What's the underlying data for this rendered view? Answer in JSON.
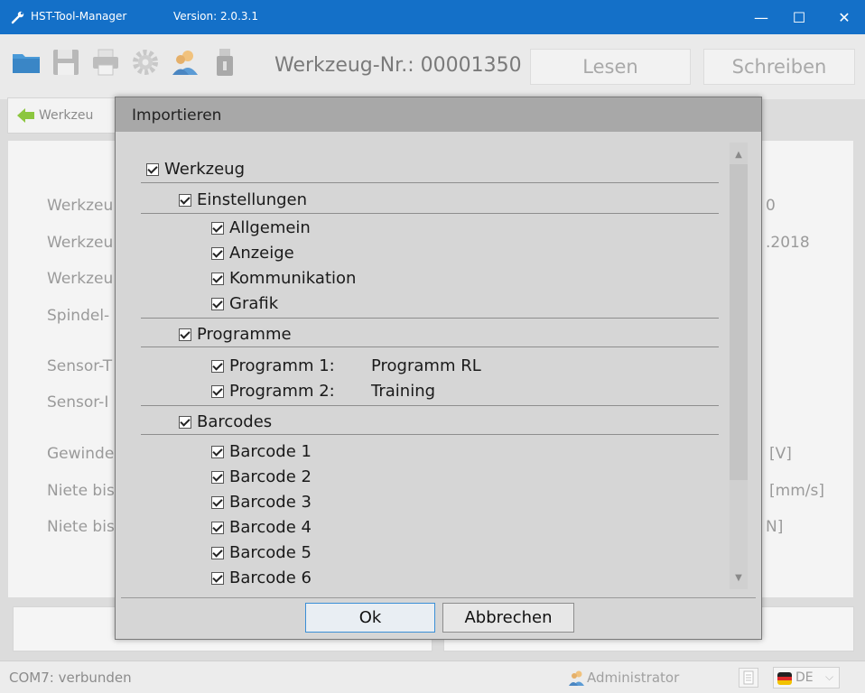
{
  "window": {
    "title": "HST-Tool-Manager",
    "version": "Version: 2.0.3.1",
    "controls": [
      "—",
      "☐",
      "✕"
    ]
  },
  "toolbar": {
    "tool_number": "Werkzeug-Nr.: 00001350",
    "read_label": "Lesen",
    "write_label": "Schreiben",
    "icons": [
      "folder-icon",
      "save-icon",
      "print-icon",
      "settings-icon",
      "users-icon",
      "usb-icon"
    ]
  },
  "breadcrumb": {
    "label": "Werkzeu"
  },
  "background_labels": {
    "left": [
      "Werkzeu",
      "Werkzeu",
      "Werkzeu",
      "Spindel-",
      "Sensor-T",
      "Sensor-I",
      "Gewinde",
      "Niete bis",
      "Niete bis"
    ],
    "right": [
      "0",
      ".2018",
      "[V]",
      "[mm/s]",
      "N]"
    ]
  },
  "dialog": {
    "title": "Importieren",
    "ok_label": "Ok",
    "cancel_label": "Abbrechen",
    "tree": {
      "root": "Werkzeug",
      "settings": {
        "label": "Einstellungen",
        "items": [
          "Allgemein",
          "Anzeige",
          "Kommunikation",
          "Grafik"
        ]
      },
      "programs": {
        "label": "Programme",
        "items": [
          {
            "label": "Programm 1:",
            "value": "Programm RL"
          },
          {
            "label": "Programm 2:",
            "value": "Training"
          }
        ]
      },
      "barcodes": {
        "label": "Barcodes",
        "items": [
          "Barcode 1",
          "Barcode 2",
          "Barcode 3",
          "Barcode 4",
          "Barcode 5",
          "Barcode 6"
        ]
      }
    }
  },
  "statusbar": {
    "connection": "COM7: verbunden",
    "user": "Administrator",
    "language": "DE"
  },
  "colors": {
    "titlebar": "#1470c8",
    "dialog_bg": "#d6d6d6",
    "dialog_title_bg": "#a8a8a8"
  }
}
